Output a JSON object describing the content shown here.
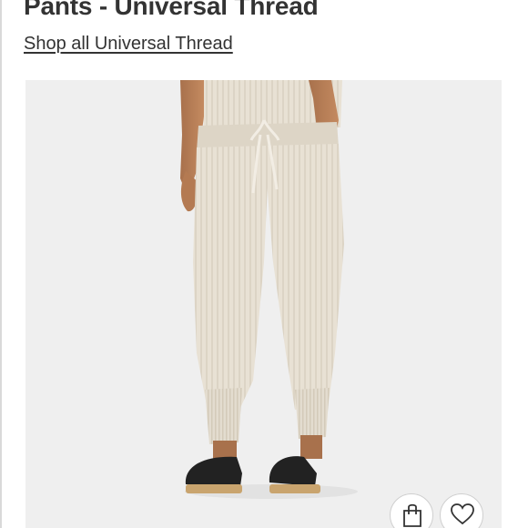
{
  "product": {
    "title": "Pants - Universal Thread",
    "trademark": "™",
    "brand_link": "Shop all Universal Thread"
  },
  "image": {
    "subject": "cream ribbed knit jogger pants with drawstring, worn with black clogs"
  },
  "actions": {
    "bag_icon": "shopping-bag-icon",
    "favorite_icon": "heart-icon"
  },
  "colors": {
    "title_text": "#333333",
    "image_background": "#efefef",
    "pants": "#e7e0d3",
    "clog": "#222222",
    "clog_sole": "#c9a46e"
  }
}
